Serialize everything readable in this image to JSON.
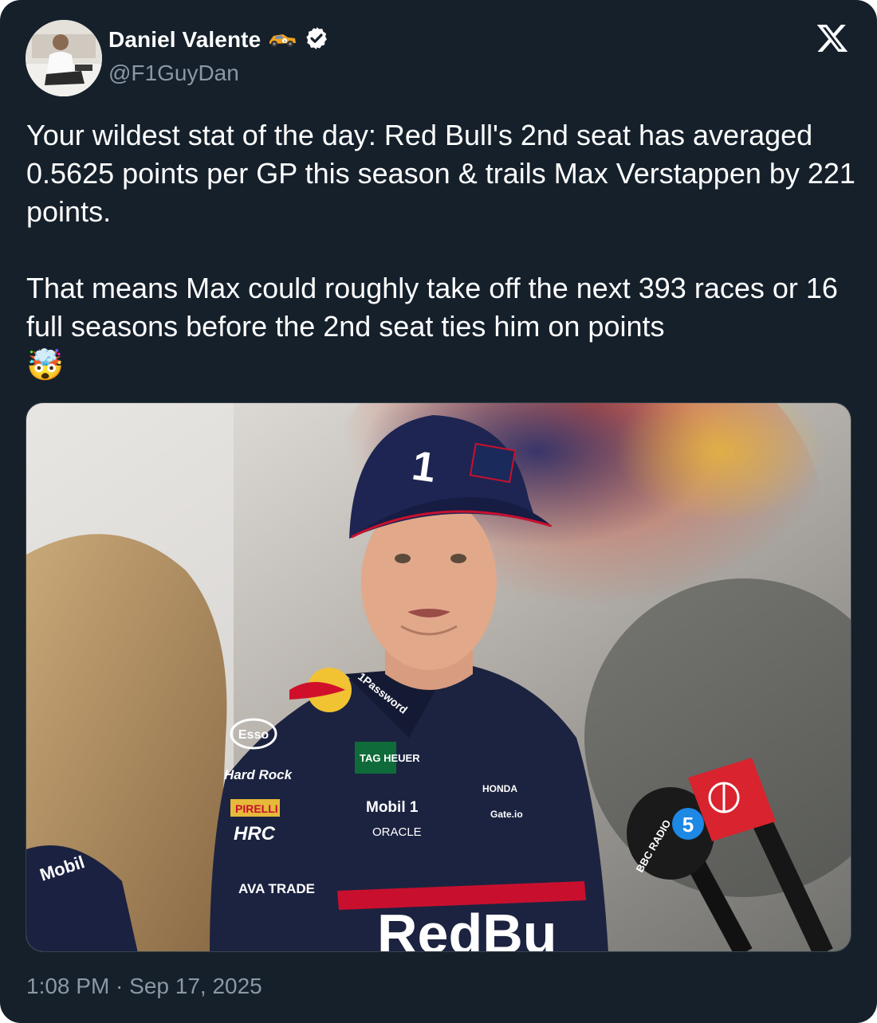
{
  "author": {
    "display_name": "Daniel Valente",
    "handle": "@F1GuyDan",
    "name_emoji": "racecar-emoji",
    "verified": true,
    "verified_icon": "verified-badge-icon"
  },
  "platform_logo": "x-logo-icon",
  "tweet": {
    "paragraph_1": "Your wildest stat of the day: Red Bull's 2nd seat has averaged 0.5625 points per GP this season & trails Max Verstappen by 221 points.",
    "paragraph_2": "That means Max could roughly take off the next 393 races or 16 full seasons before the 2nd seat ties him on points",
    "emoji": "🤯"
  },
  "media": {
    "type": "photo",
    "cap_number": "1",
    "sponsor_labels": [
      "Esso",
      "Hard Rock",
      "PIRELLI",
      "HRC",
      "AVA TRADE",
      "TAG HEUER",
      "Mobil 1",
      "ORACLE",
      "1Password",
      "HONDA",
      "Gate.io",
      "RedBu"
    ],
    "mic_labels": [
      "BBC RADIO",
      "5"
    ]
  },
  "timestamp": "1:08 PM · Sep 17, 2025",
  "colors": {
    "background": "#15202b",
    "text": "#ffffff",
    "secondary_text": "#8b98a5",
    "verified_badge": "#ffffff"
  }
}
